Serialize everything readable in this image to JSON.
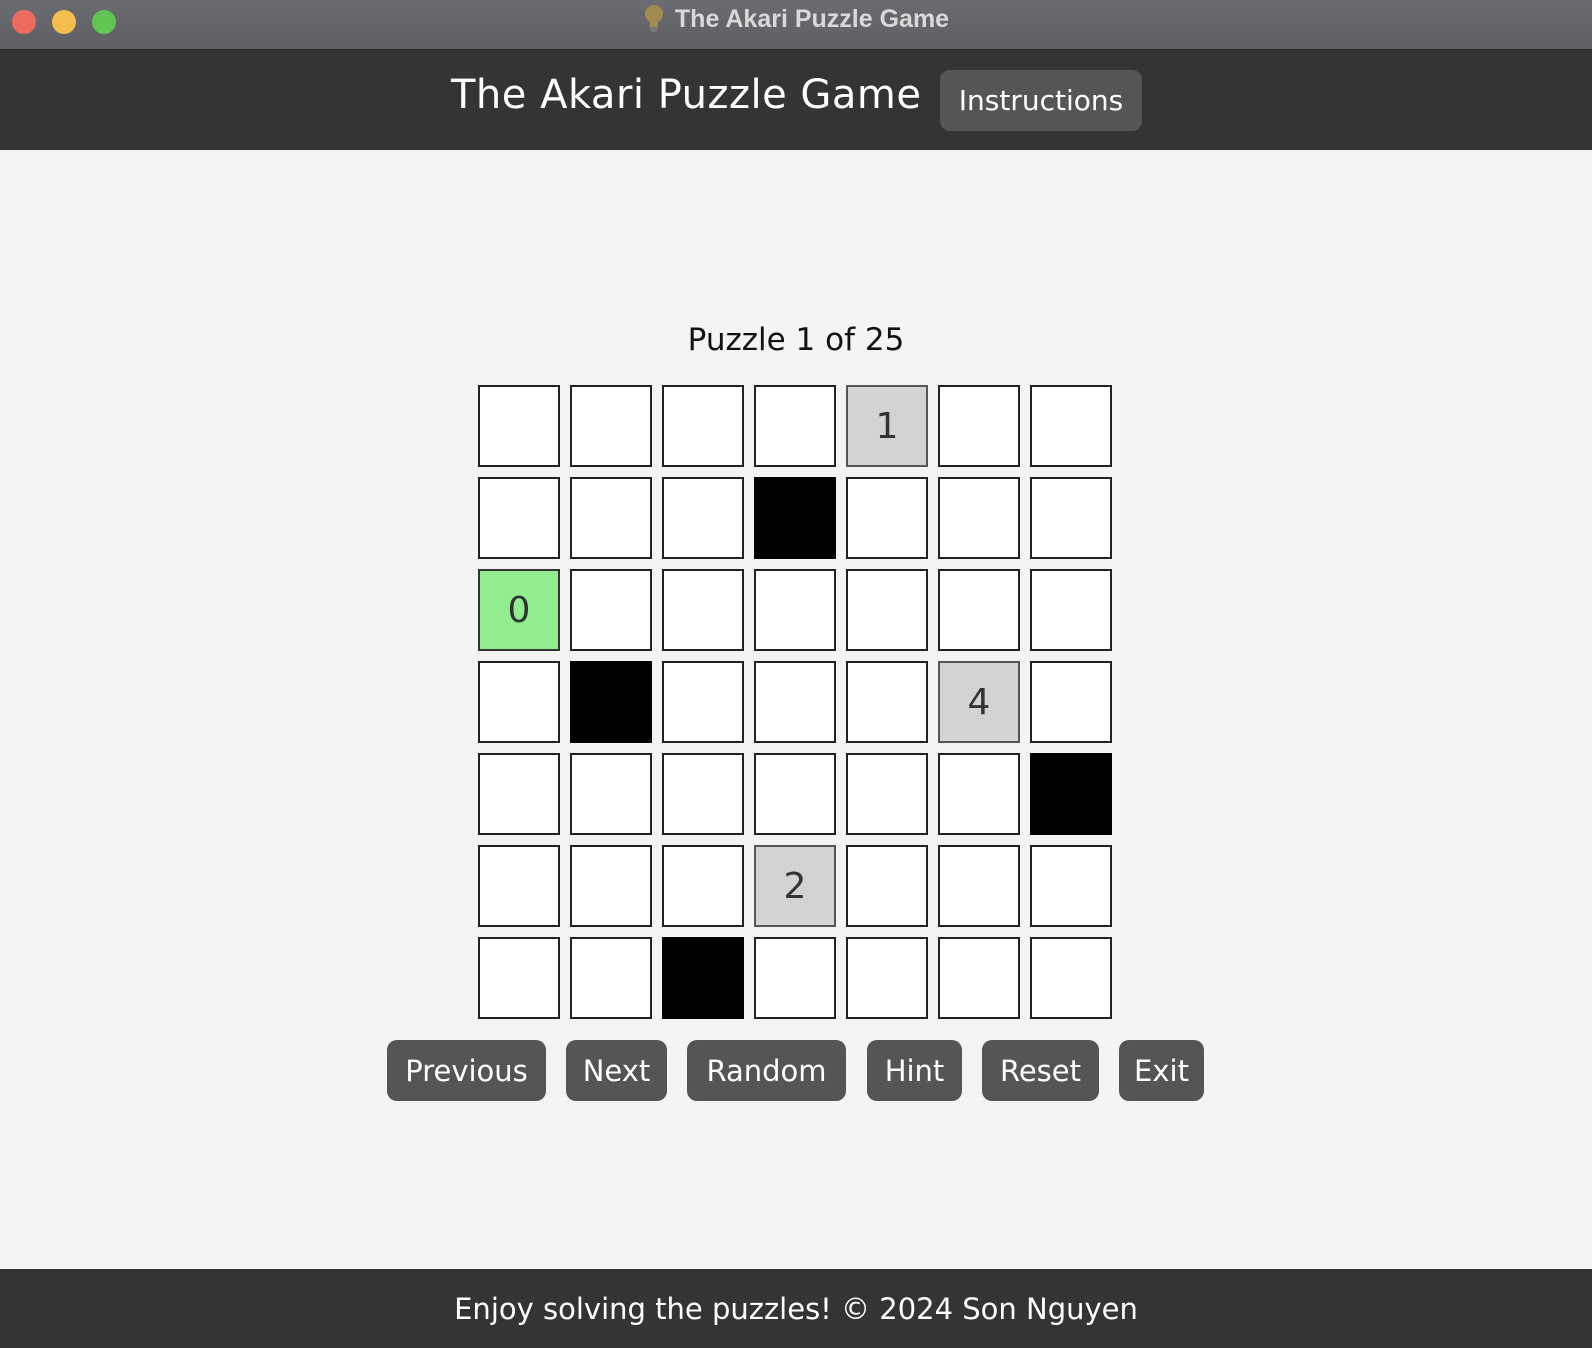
{
  "window": {
    "title": "The Akari Puzzle Game",
    "title_icon": "lightbulb-icon"
  },
  "header": {
    "title": "The Akari Puzzle Game",
    "instructions_label": "Instructions"
  },
  "puzzle": {
    "label": "Puzzle 1 of 25",
    "current": 1,
    "total": 25,
    "rows": 7,
    "cols": 7,
    "grid": [
      [
        "",
        "",
        "",
        "",
        "1",
        "",
        ""
      ],
      [
        "",
        "",
        "",
        "#",
        "",
        "",
        ""
      ],
      [
        "0*",
        "",
        "",
        "",
        "",
        "",
        ""
      ],
      [
        "",
        "#",
        "",
        "",
        "",
        "4",
        ""
      ],
      [
        "",
        "",
        "",
        "",
        "",
        "",
        "#"
      ],
      [
        "",
        "",
        "",
        "2",
        "",
        "",
        ""
      ],
      [
        "",
        "",
        "#",
        "",
        "",
        "",
        ""
      ]
    ],
    "legend": {
      "#": "black wall",
      "digit": "numbered wall",
      "*": "satisfied clue (green)"
    }
  },
  "controls": {
    "previous_label": "Previous",
    "next_label": "Next",
    "random_label": "Random",
    "hint_label": "Hint",
    "reset_label": "Reset",
    "exit_label": "Exit"
  },
  "footer": {
    "text": "Enjoy solving the puzzles! © 2024 Son Nguyen"
  },
  "colors": {
    "header_bg": "#343434",
    "button_bg": "#555555",
    "clue_bg": "#d3d3d3",
    "satisfied_clue_bg": "#90ee90",
    "wall": "#000000",
    "cell": "#ffffff",
    "page_bg": "#f4f4f4"
  }
}
